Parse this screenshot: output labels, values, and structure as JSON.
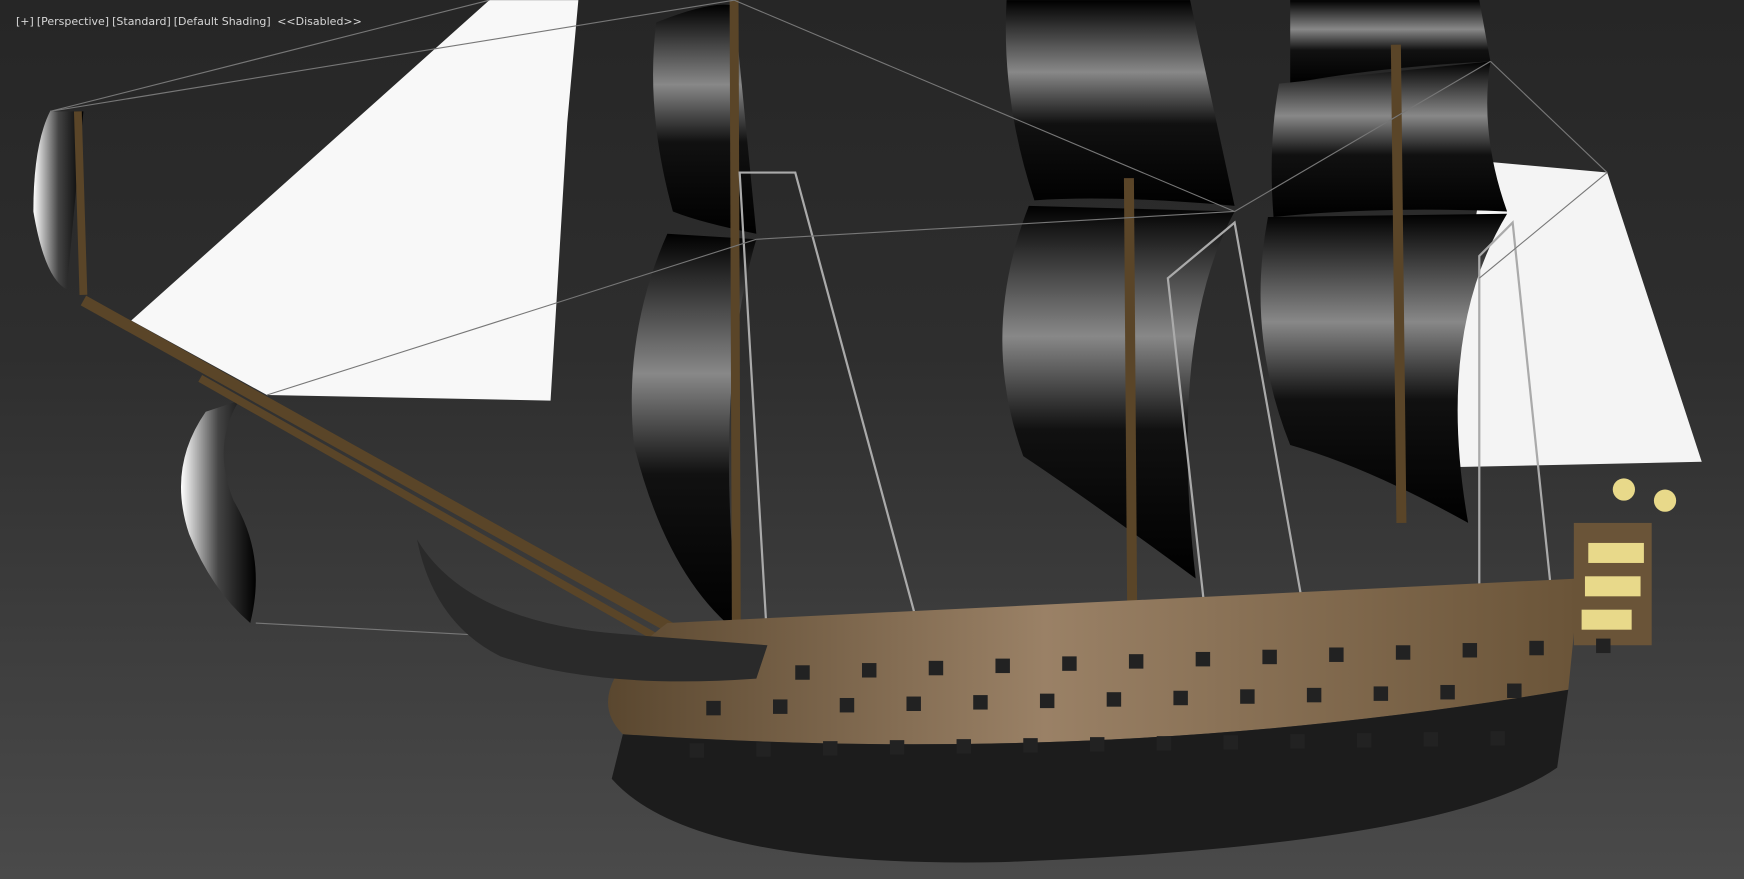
{
  "viewport": {
    "menus": [
      "[+]",
      "[Perspective]",
      "[Standard]",
      "[Default Shading]",
      " <<Disabled>>"
    ]
  },
  "scene": {
    "subject": "ship-model",
    "colors": {
      "background_top": "#262626",
      "background_bottom": "#4a4a4a",
      "hull_wood": "#7a6247",
      "hull_dark": "#1c1c1c",
      "sail_white": "#f8f8f8"
    }
  }
}
